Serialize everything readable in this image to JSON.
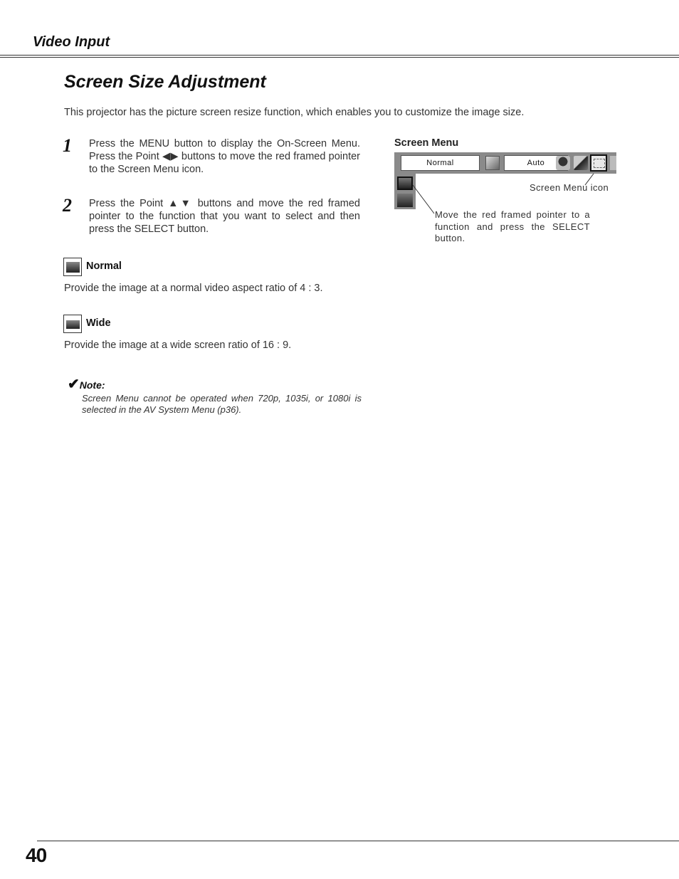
{
  "header": {
    "section": "Video Input"
  },
  "title": "Screen Size Adjustment",
  "intro": "This projector has the picture screen resize function, which enables you to customize the image size.",
  "steps": [
    {
      "number": "1",
      "text": "Press the MENU button to display the On-Screen Menu.  Press the Point ◀▶ buttons to move the red framed pointer to the Screen Menu icon."
    },
    {
      "number": "2",
      "text": "Press the Point ▲▼ buttons and move the red framed pointer to the function that you want to select and then press the SELECT button."
    }
  ],
  "screen_menu": {
    "label": "Screen Menu",
    "field1": "Normal",
    "field2": "Auto",
    "icons": [
      "image-adjust-icon",
      "color-icon",
      "color-adjust-icon",
      "screen-menu-icon",
      "setting-icon"
    ],
    "callout_icon": "Screen Menu icon",
    "callout_pointer": "Move the red framed pointer to a function and press the SELECT button."
  },
  "items": [
    {
      "title": "Normal",
      "description": "Provide the image at a normal video aspect ratio of 4 : 3."
    },
    {
      "title": "Wide",
      "description": "Provide the image at a wide screen ratio of 16 : 9."
    }
  ],
  "note": {
    "check": "✔",
    "heading": "Note:",
    "text": "Screen Menu cannot be operated when 720p, 1035i, or 1080i is selected in the AV System Menu (p36)."
  },
  "footer": {
    "page_number": "40"
  }
}
